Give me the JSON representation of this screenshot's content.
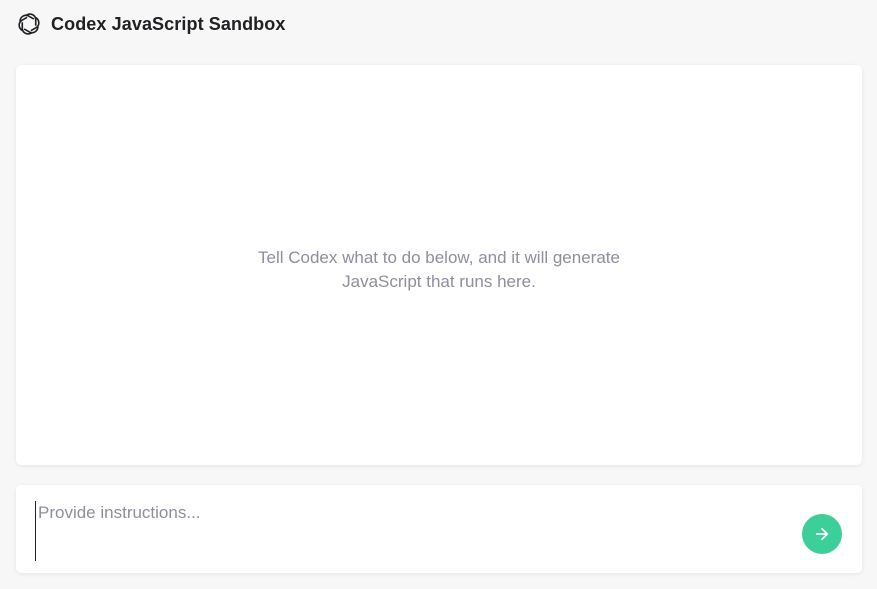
{
  "app": {
    "title": "Codex JavaScript Sandbox",
    "logo_icon": "openai-logo-icon"
  },
  "output": {
    "empty_message": "Tell Codex what to do below, and it will generate JavaScript that runs here."
  },
  "input": {
    "value": "",
    "placeholder": "Provide instructions..."
  },
  "submit": {
    "icon": "arrow-right-icon",
    "color": "#3dcf9a"
  },
  "colors": {
    "background": "#f7f7f8",
    "panel": "#ffffff",
    "muted_text": "#8e8ea0",
    "accent": "#3dcf9a"
  }
}
